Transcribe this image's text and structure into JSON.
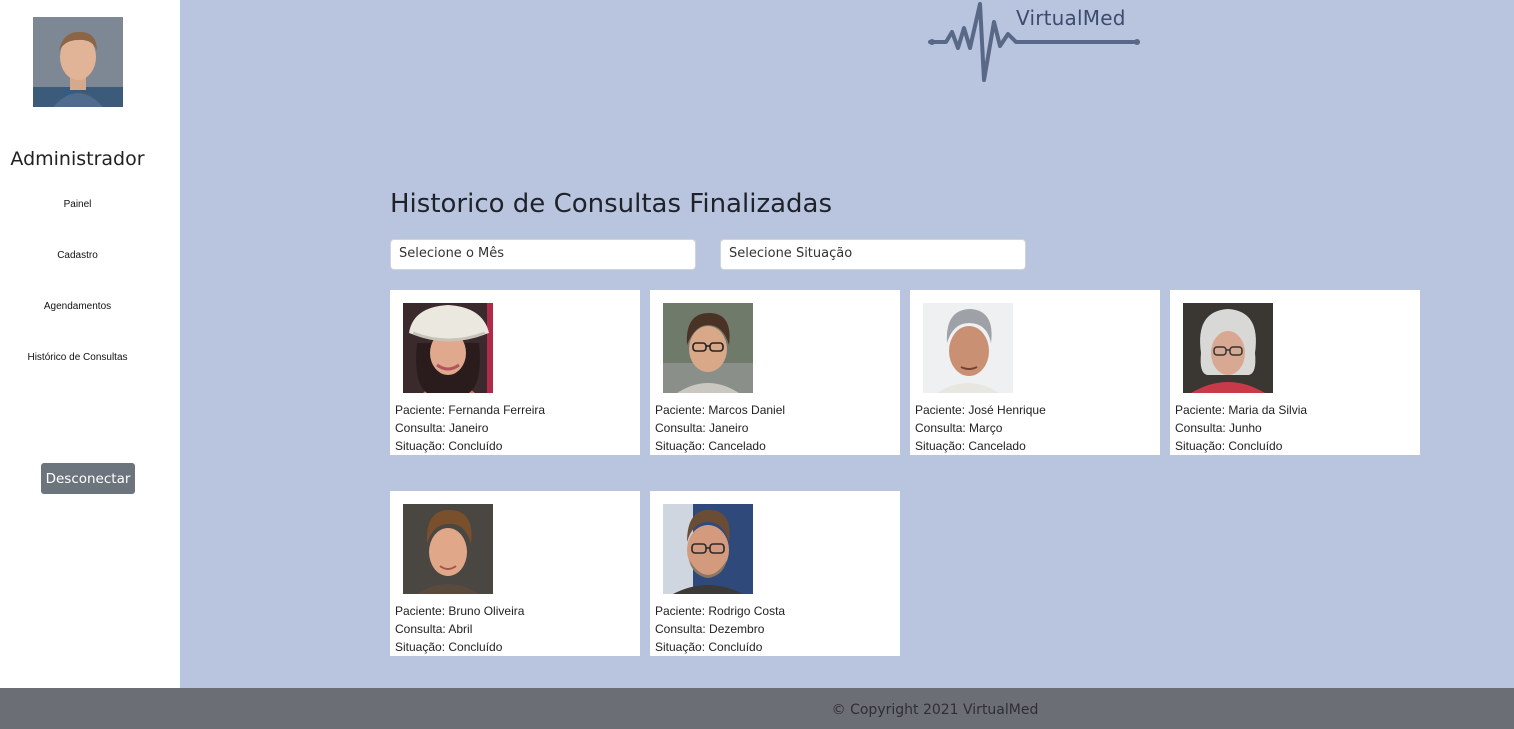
{
  "sidebar": {
    "role_title": "Administrador",
    "avatar_icon": "user-avatar",
    "nav": [
      {
        "label": "Painel"
      },
      {
        "label": "Cadastro"
      },
      {
        "label": "Agendamentos"
      },
      {
        "label": "Histórico de Consultas"
      }
    ],
    "logout_label": "Desconectar"
  },
  "brand": {
    "name": "VirtualMed",
    "logo_icon": "heartbeat-line-icon",
    "color": "#5a6887"
  },
  "main": {
    "title": "Historico de Consultas Finalizadas",
    "filters": {
      "month_value": "Selecione o Mês",
      "status_value": "Selecione Situação"
    },
    "cards": [
      {
        "patient": "Paciente: Fernanda Ferreira",
        "consult": "Consulta: Janeiro",
        "status": "Situação: Concluído"
      },
      {
        "patient": "Paciente: Marcos Daniel",
        "consult": "Consulta: Janeiro",
        "status": "Situação: Cancelado"
      },
      {
        "patient": "Paciente: José Henrique",
        "consult": "Consulta: Março",
        "status": "Situação: Cancelado"
      },
      {
        "patient": "Paciente: Maria da Silvia",
        "consult": "Consulta: Junho",
        "status": "Situação: Concluído"
      },
      {
        "patient": "Paciente: Bruno Oliveira",
        "consult": "Consulta: Abril",
        "status": "Situação: Concluído"
      },
      {
        "patient": "Paciente: Rodrigo Costa",
        "consult": "Consulta: Dezembro",
        "status": "Situação: Concluído"
      }
    ]
  },
  "footer": {
    "text": "© Copyright 2021 VirtualMed"
  },
  "colors": {
    "background": "#b9c5df",
    "sidebar": "#ffffff",
    "button": "#6c757d",
    "footer": "#6c6e76"
  }
}
